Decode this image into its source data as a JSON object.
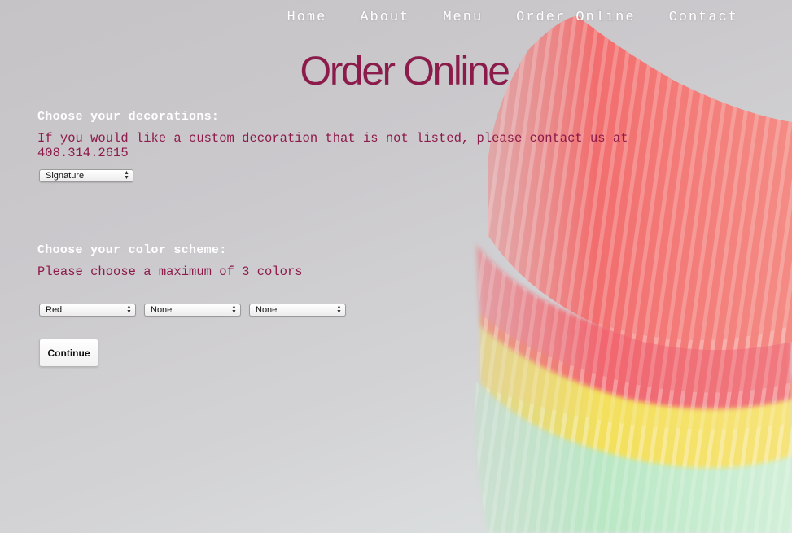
{
  "nav": {
    "items": [
      {
        "label": "Home"
      },
      {
        "label": "About"
      },
      {
        "label": "Menu"
      },
      {
        "label": "Order Online"
      },
      {
        "label": "Contact"
      }
    ]
  },
  "page": {
    "title": "Order Online"
  },
  "decorations": {
    "heading": "Choose your decorations:",
    "note": "If you would like a custom decoration that is not listed, please contact us at 408.314.2615",
    "selected": "Signature"
  },
  "colors": {
    "heading": "Choose your color scheme:",
    "note": "Please choose a maximum of 3 colors",
    "selects": [
      {
        "selected": "Red"
      },
      {
        "selected": "None"
      },
      {
        "selected": "None"
      }
    ]
  },
  "actions": {
    "continue_label": "Continue"
  },
  "theme": {
    "accent": "#8c1a4a",
    "nav_text": "#ffffff"
  },
  "background": {
    "icon": "cupcake-liners-image"
  }
}
